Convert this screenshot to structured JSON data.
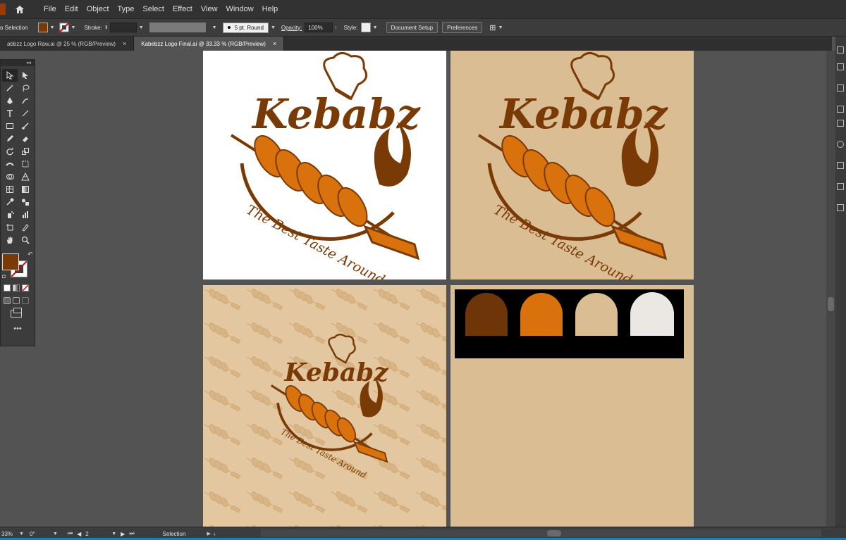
{
  "menubar": {
    "items": [
      "File",
      "Edit",
      "Object",
      "Type",
      "Select",
      "Effect",
      "View",
      "Window",
      "Help"
    ]
  },
  "controlbar": {
    "selection_label": "o Selection",
    "stroke_label": "Stroke:",
    "brush_label": "5 pt. Round",
    "opacity_label": "Opacity:",
    "opacity_value": "100%",
    "style_label": "Style:",
    "document_setup": "Document Setup",
    "preferences": "Preferences"
  },
  "tabs": [
    {
      "label": "abbzz Logo Raw.ai @ 25 % (RGB/Preview)",
      "close": "×"
    },
    {
      "label": "Kabebzz Logo Final.ai @ 33.33 % (RGB/Preview)",
      "close": "×"
    }
  ],
  "logo": {
    "brand": "Kebabz",
    "tagline": "The Best Taste Around"
  },
  "palette": {
    "colors": [
      "#6e3508",
      "#d9720c",
      "#dbbd94",
      "#ebe8e3"
    ]
  },
  "colors": {
    "fill": "#7a3a05",
    "brand_dark": "#7a3a05",
    "brand_orange": "#d9720c"
  },
  "statusbar": {
    "zoom": "33%",
    "rotation": "0°",
    "page": "2",
    "status": "Selection"
  }
}
